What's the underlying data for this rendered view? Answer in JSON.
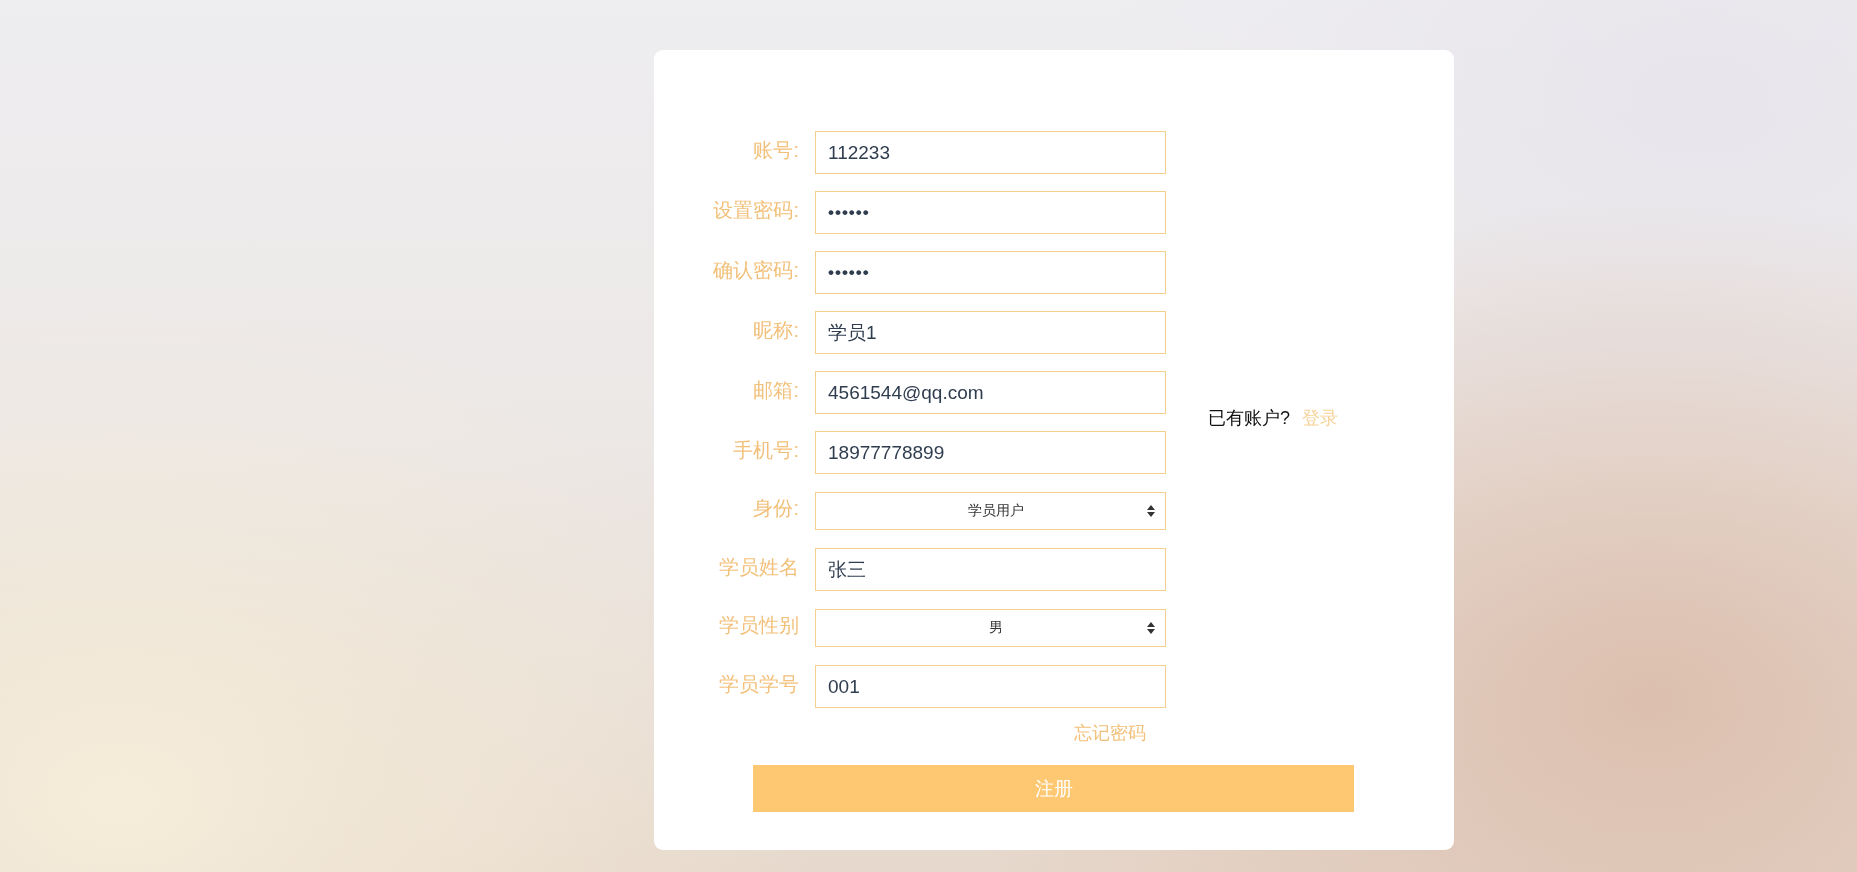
{
  "form": {
    "fields": [
      {
        "kind": "text",
        "label": "账号:",
        "value": "112233"
      },
      {
        "kind": "password",
        "label": "设置密码:",
        "value": "••••••"
      },
      {
        "kind": "password",
        "label": "确认密码:",
        "value": "••••••"
      },
      {
        "kind": "text",
        "label": "昵称:",
        "value": "学员1"
      },
      {
        "kind": "text",
        "label": "邮箱:",
        "value": "4561544@qq.com"
      },
      {
        "kind": "text",
        "label": "手机号:",
        "value": "18977778899"
      },
      {
        "kind": "select",
        "label": "身份:",
        "value": "学员用户"
      },
      {
        "kind": "text",
        "label": "学员姓名",
        "value": "张三"
      },
      {
        "kind": "select",
        "label": "学员性别",
        "value": "男"
      },
      {
        "kind": "text",
        "label": "学员学号",
        "value": "001"
      }
    ],
    "forgot_password_link": "忘记密码",
    "submit_button": "注册"
  },
  "login_prompt": {
    "text": "已有账户?",
    "link": "登录"
  }
}
